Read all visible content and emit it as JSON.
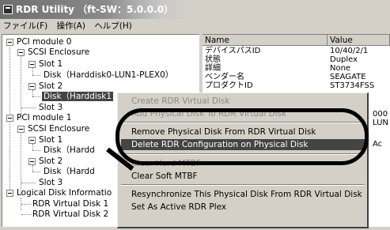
{
  "window": {
    "title": "RDR Utility （ft-SW：5.0.0.0）"
  },
  "menubar": {
    "items": [
      "ファイル(F)",
      "操作(A)",
      "ヘルプ(H)"
    ]
  },
  "tree": {
    "pci0": "PCI module 0",
    "scsi0": "SCSI Enclosure",
    "slot0_1": "Slot 1",
    "disk0_1": "Disk（Harddisk0-LUN1-PLEX0）",
    "slot0_2": "Slot 2",
    "disk0_2": "Disk（Harddisk1",
    "slot0_3": "Slot 3",
    "pci1": "PCI module 1",
    "scsi1": "SCSI Enclosure",
    "slot1_1": "Slot 1",
    "disk1_1": "Disk（Hardd",
    "slot1_2": "Slot 2",
    "disk1_2": "Disk（Hardd",
    "slot1_3": "Slot 3",
    "logical": "Logical Disk Informatio",
    "rdr1": "RDR Virtual Disk 1",
    "rdr2": "RDR Virtual Disk 2"
  },
  "list": {
    "headers": {
      "name": "Name",
      "value": "Value"
    },
    "rows": [
      {
        "name": "デバイスパスID",
        "value": "10/40/2/1"
      },
      {
        "name": "状態",
        "value": "Duplex"
      },
      {
        "name": "詳細",
        "value": "None"
      },
      {
        "name": "ベンダー名",
        "value": "SEAGATE"
      },
      {
        "name": "プロダクトID",
        "value": "ST3734FSS"
      }
    ],
    "partial_right": {
      "r1": "000",
      "r2": "LUN",
      "r3": "Ac"
    }
  },
  "context_menu": {
    "create": "Create RDR Virtual Disk",
    "add": "Add Physical Disk To RDR Virtual Disk",
    "remove": "Remove Physical Disk From RDR Virtual Disk",
    "delete": "Delete RDR Configuration on Physical Disk",
    "clear_hard": "Clear Hard MTBF",
    "clear_soft": "Clear Soft MTBF",
    "resync": "Resynchronize This Physical Disk From RDR Virtual Disk",
    "set_active": "Set As Active RDR Plex"
  },
  "colors": {
    "selection": "#444444",
    "menu_face": "#d4d0c8",
    "disabled_text": "#8a8a8a",
    "annotation": "#000000"
  }
}
